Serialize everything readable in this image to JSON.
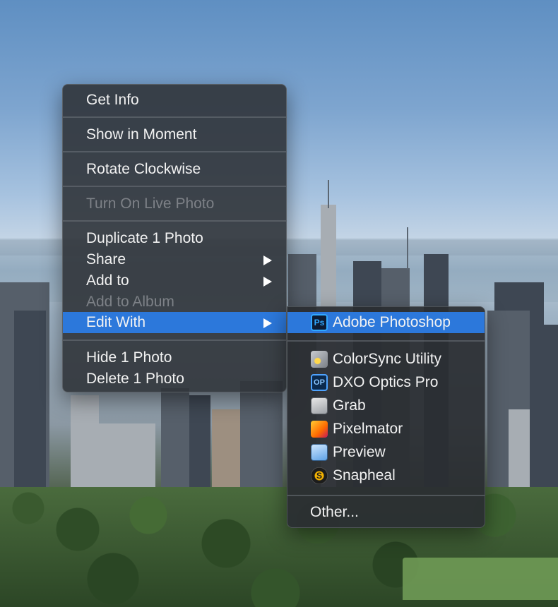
{
  "context_menu": {
    "get_info": "Get Info",
    "show_in_moment": "Show in Moment",
    "rotate_clockwise": "Rotate Clockwise",
    "turn_on_live_photo": "Turn On Live Photo",
    "duplicate": "Duplicate 1 Photo",
    "share": "Share",
    "add_to": "Add to",
    "add_to_album": "Add to Album",
    "edit_with": "Edit With",
    "hide": "Hide 1 Photo",
    "delete": "Delete 1 Photo"
  },
  "edit_with_submenu": {
    "apps": [
      {
        "label": "Adobe Photoshop",
        "icon": "photoshop-icon",
        "icon_text": "Ps"
      },
      {
        "label": "ColorSync Utility",
        "icon": "colorsync-icon"
      },
      {
        "label": "DXO Optics Pro",
        "icon": "dxo-icon",
        "icon_text": "OP"
      },
      {
        "label": "Grab",
        "icon": "grab-icon"
      },
      {
        "label": "Pixelmator",
        "icon": "pixelmator-icon"
      },
      {
        "label": "Preview",
        "icon": "preview-icon"
      },
      {
        "label": "Snapheal",
        "icon": "snapheal-icon",
        "icon_text": "S"
      }
    ],
    "other": "Other..."
  },
  "colors": {
    "highlight": "#2c78db",
    "menu_bg": "#30343a",
    "text": "#f2f2f2",
    "disabled_text": "#7d8187"
  }
}
